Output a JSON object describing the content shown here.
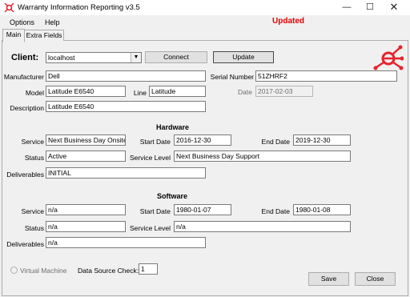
{
  "window": {
    "title": "Warranty Information Reporting v3.5",
    "status": "Updated"
  },
  "menu": {
    "options": "Options",
    "help": "Help"
  },
  "tabs": {
    "main": "Main",
    "extra": "Extra Fields"
  },
  "client": {
    "label": "Client:",
    "value": "localhost",
    "connect": "Connect",
    "update": "Update"
  },
  "device": {
    "manufacturer_label": "Manufacturer",
    "manufacturer": "Dell",
    "serial_label": "Serial Number",
    "serial": "51ZHRF2",
    "model_label": "Model",
    "model": "Latitude E6540",
    "line_label": "Line",
    "line": "Latitude",
    "date_label": "Date",
    "date": "2017-02-03",
    "description_label": "Description",
    "description": "Latitude E6540"
  },
  "hardware": {
    "title": "Hardware",
    "service_label": "Service",
    "service": "Next Business Day Onsite Se",
    "start_label": "Start Date",
    "start": "2016-12-30",
    "end_label": "End Date",
    "end": "2019-12-30",
    "status_label": "Status",
    "status": "Active",
    "level_label": "Service Level",
    "level": "Next Business Day Support",
    "deliverables_label": "Deliverables",
    "deliverables": "INITIAL"
  },
  "software": {
    "title": "Software",
    "service_label": "Service",
    "service": "n/a",
    "start_label": "Start Date",
    "start": "1980-01-07",
    "end_label": "End Date",
    "end": "1980-01-08",
    "status_label": "Status",
    "status": "n/a",
    "level_label": "Service Level",
    "level": "n/a",
    "deliverables_label": "Deliverables",
    "deliverables": "n/a"
  },
  "footer": {
    "virtual_machine": "Virtual Machine",
    "data_source_label": "Data Source Check:",
    "data_source": "1",
    "save": "Save",
    "close": "Close"
  },
  "colors": {
    "accent": "#e00000",
    "logo": "#e8222c"
  },
  "icons": {
    "app": "app-logo-icon",
    "logo": "network-logo-icon"
  }
}
